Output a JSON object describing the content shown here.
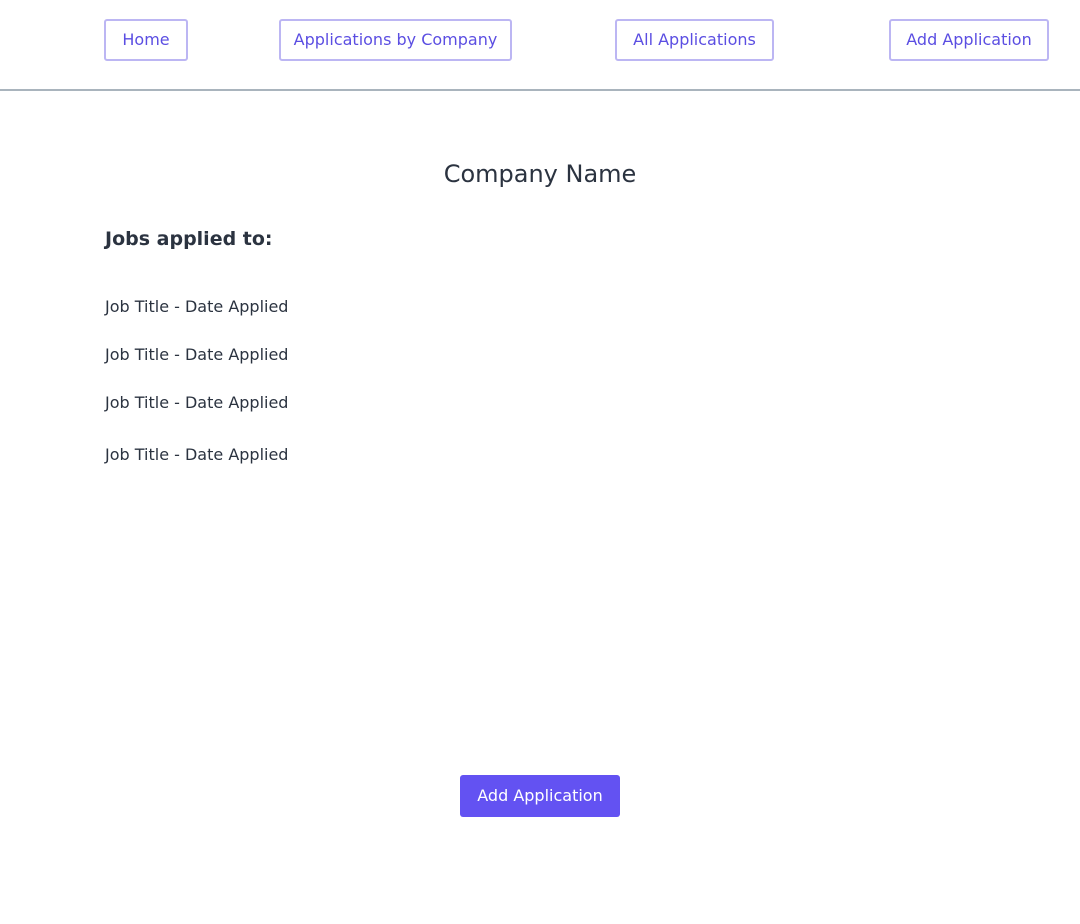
{
  "nav": {
    "home_label": "Home",
    "by_company_label": "Applications by Company",
    "all_label": "All Applications",
    "add_label": "Add Application"
  },
  "main": {
    "company_name": "Company Name",
    "jobs_heading": "Jobs applied to:",
    "jobs": [
      "Job Title - Date Applied",
      "Job Title - Date Applied",
      "Job Title - Date Applied",
      "Job Title - Date Applied"
    ],
    "add_button_label": "Add Application"
  },
  "colors": {
    "accent": "#6352f2",
    "nav_border": "#bcb6f3",
    "text": "#2b3340",
    "divider": "#a9b4bd"
  }
}
